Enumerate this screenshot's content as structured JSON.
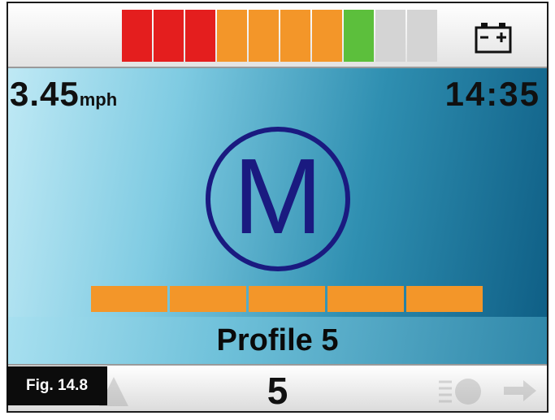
{
  "battery": {
    "segments": [
      "#e41e1e",
      "#e41e1e",
      "#e41e1e",
      "#f39629",
      "#f39629",
      "#f39629",
      "#f39629",
      "#5cbf3c",
      "#d4d4d4",
      "#d4d4d4"
    ],
    "level_segments_lit": 8,
    "level_segments_total": 10,
    "icon": "battery-icon"
  },
  "status": {
    "speed_value": "3.45",
    "speed_unit": "mph",
    "time": "14:35"
  },
  "mode": {
    "letter": "M",
    "color": "#1a1a80"
  },
  "speed_level": {
    "bars_lit": 5,
    "bars_total": 5,
    "color": "#f39629"
  },
  "profile": {
    "label": "Profile 5",
    "number": "5"
  },
  "bottom_icons": [
    "left-arrow-icon",
    "horn-icon",
    "lights-icon",
    "right-arrow-icon"
  ],
  "figure": {
    "label": "Fig. 14.8"
  }
}
